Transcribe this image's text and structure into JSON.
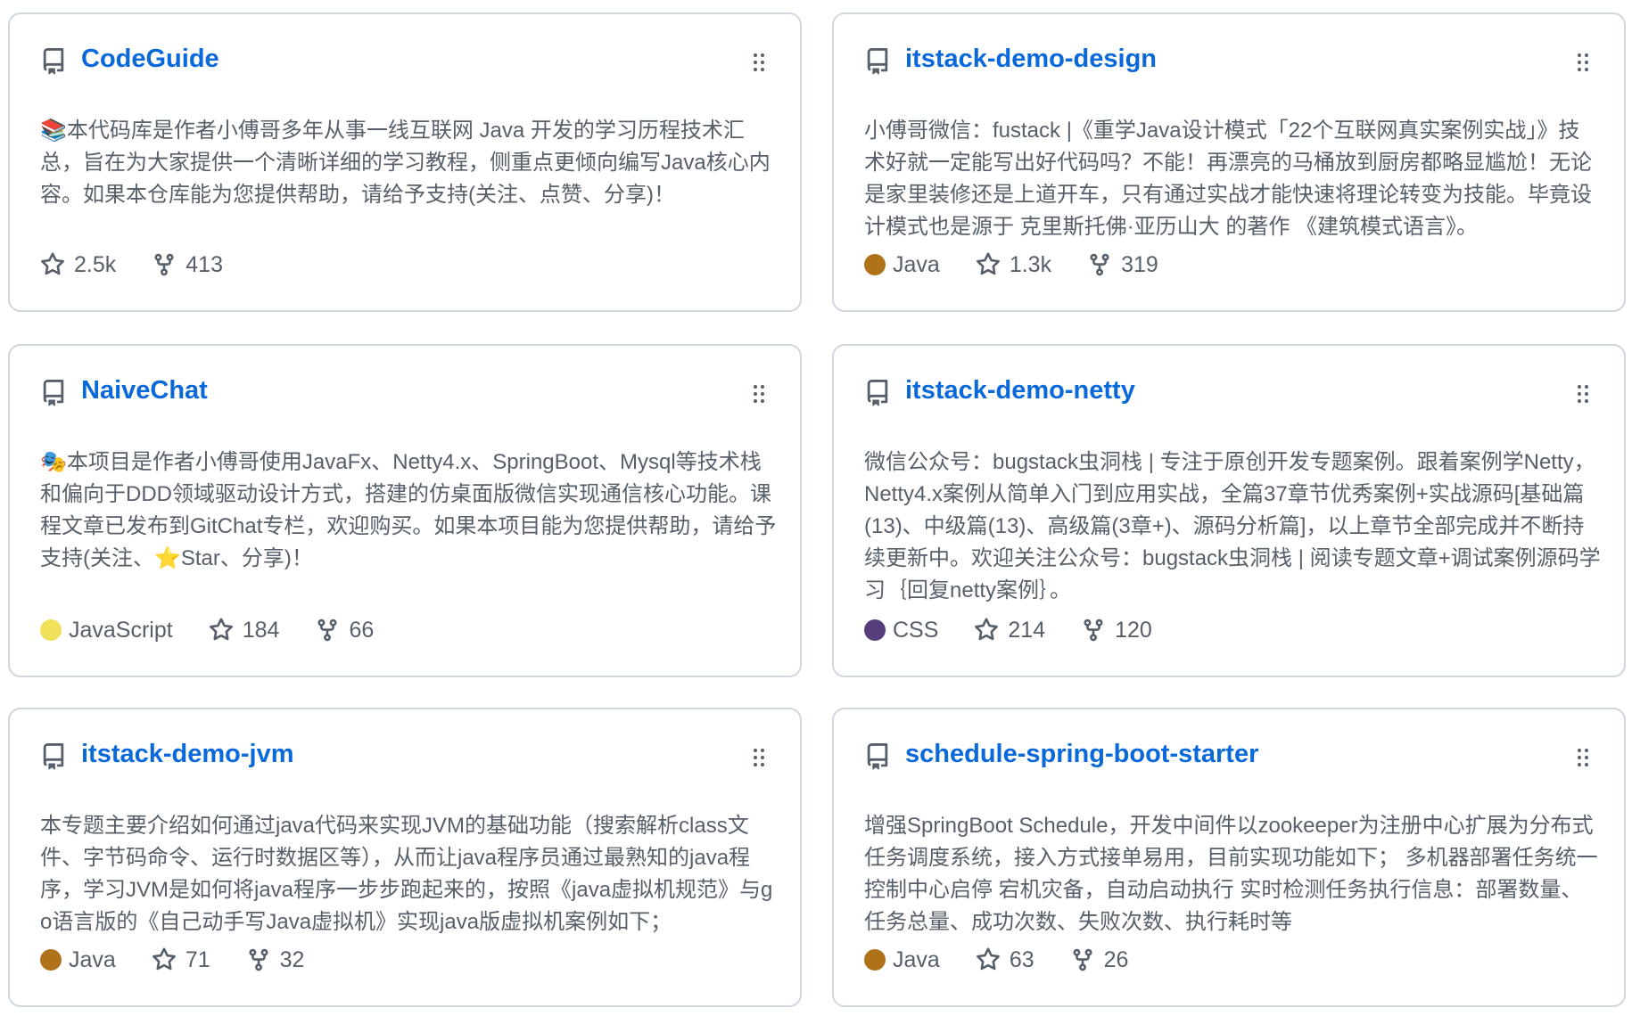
{
  "repos": [
    {
      "name": "CodeGuide",
      "icon": "repo-icon",
      "emoji": "📚",
      "description": "本代码库是作者小傅哥多年从事一线互联网 Java 开发的学习历程技术汇总，旨在为大家提供一个清晰详细的学习教程，侧重点更倾向编写Java核心内容。如果本仓库能为您提供帮助，请给予支持(关注、点赞、分享)！",
      "language": "",
      "language_color": "",
      "stars": "2.5k",
      "forks": "413"
    },
    {
      "name": "itstack-demo-design",
      "icon": "repo-icon",
      "emoji": "",
      "description": "小傅哥微信：fustack |《重学Java设计模式「22个互联网真实案例实战」》技术好就一定能写出好代码吗？不能！再漂亮的马桶放到厨房都略显尴尬！无论是家里装修还是上道开车，只有通过实战才能快速将理论转变为技能。毕竟设计模式也是源于 克里斯托佛·亚历山大 的著作 《建筑模式语言》。",
      "language": "Java",
      "language_color": "#b07219",
      "stars": "1.3k",
      "forks": "319"
    },
    {
      "name": "NaiveChat",
      "icon": "repo-icon",
      "emoji": "🎭",
      "description": "本项目是作者小傅哥使用JavaFx、Netty4.x、SpringBoot、Mysql等技术栈和偏向于DDD领域驱动设计方式，搭建的仿桌面版微信实现通信核心功能。课程文章已发布到GitChat专栏，欢迎购买。如果本项目能为您提供帮助，请给予支持(关注、⭐Star、分享)！",
      "language": "JavaScript",
      "language_color": "#f1e05a",
      "stars": "184",
      "forks": "66"
    },
    {
      "name": "itstack-demo-netty",
      "icon": "repo-icon",
      "emoji": "",
      "description": "微信公众号：bugstack虫洞栈 | 专注于原创开发专题案例。跟着案例学Netty，Netty4.x案例从简单入门到应用实战，全篇37章节优秀案例+实战源码[基础篇(13)、中级篇(13)、高级篇(3章+)、源码分析篇]，以上章节全部完成并不断持续更新中。欢迎关注公众号：bugstack虫洞栈 | 阅读专题文章+调试案例源码学习｛回复netty案例｝。",
      "language": "CSS",
      "language_color": "#563d7c",
      "stars": "214",
      "forks": "120"
    },
    {
      "name": "itstack-demo-jvm",
      "icon": "repo-icon",
      "emoji": "",
      "description": "本专题主要介绍如何通过java代码来实现JVM的基础功能（搜索解析class文件、字节码命令、运行时数据区等），从而让java程序员通过最熟知的java程序，学习JVM是如何将java程序一步步跑起来的，按照《java虚拟机规范》与go语言版的《自己动手写Java虚拟机》实现java版虚拟机案例如下；",
      "language": "Java",
      "language_color": "#b07219",
      "stars": "71",
      "forks": "32"
    },
    {
      "name": "schedule-spring-boot-starter",
      "icon": "repo-icon",
      "emoji": "",
      "description": "增强SpringBoot Schedule，开发中间件以zookeeper为注册中心扩展为分布式任务调度系统，接入方式接单易用，目前实现功能如下； 多机器部署任务统一控制中心启停 宕机灾备，自动启动执行 实时检测任务执行信息：部署数量、任务总量、成功次数、失败次数、执行耗时等",
      "language": "Java",
      "language_color": "#b07219",
      "stars": "63",
      "forks": "26"
    }
  ]
}
